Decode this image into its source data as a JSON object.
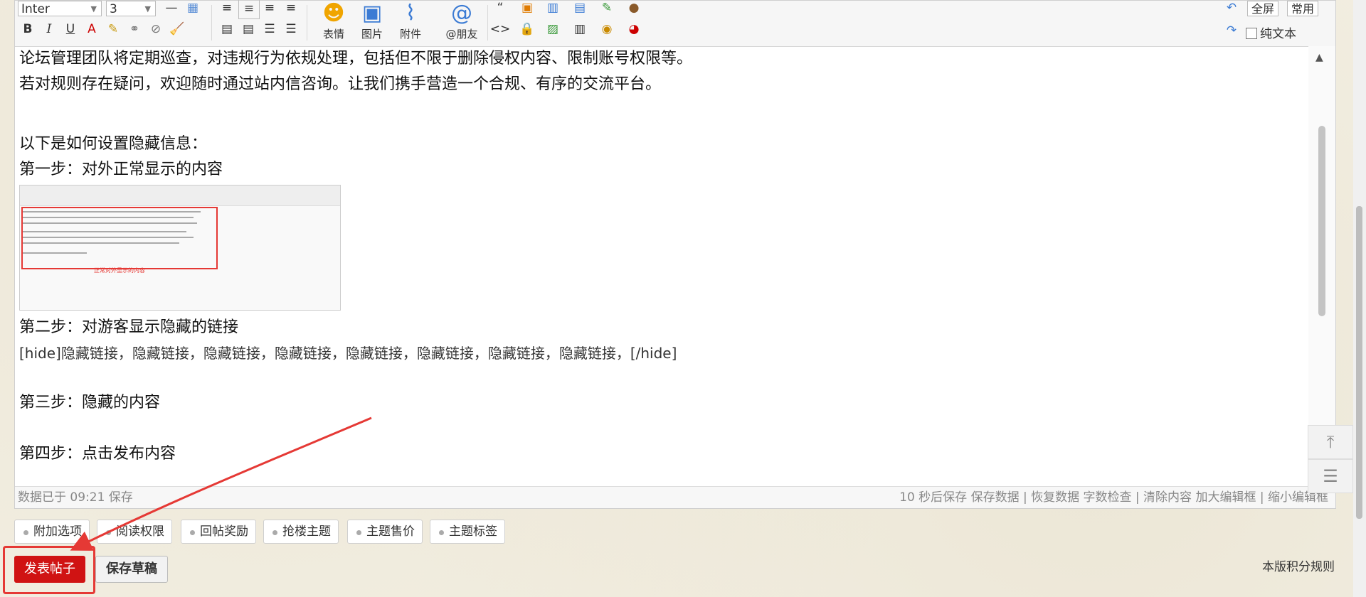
{
  "toolbar": {
    "font_select": "Inter",
    "size_select": "3",
    "big_buttons": [
      {
        "label": "表情"
      },
      {
        "label": "图片"
      },
      {
        "label": "附件"
      },
      {
        "label": "@朋友"
      }
    ],
    "fullscreen_label": "全屏",
    "common_label": "常用",
    "plaintext_label": "纯文本"
  },
  "content": {
    "lines": [
      "论坛管理团队将定期巡查，对违规行为依规处理，包括但不限于删除侵权内容、限制账号权限等。",
      "若对规则存在疑问，欢迎随时通过站内信咨询。让我们携手营造一个合规、有序的交流平台。",
      "以下是如何设置隐藏信息：",
      "第一步：对外正常显示的内容",
      "第二步：对游客显示隐藏的链接",
      "[hide]隐藏链接，隐藏链接，隐藏链接，隐藏链接，隐藏链接，隐藏链接，隐藏链接，隐藏链接，[/hide]",
      "第三步：隐藏的内容",
      "第四步：点击发布内容"
    ],
    "thumbnail_caption": "正常对外显示的内容"
  },
  "status": {
    "saved": "数据已于 09:21 保存",
    "right": "10 秒后保存 保存数据 | 恢复数据    字数检查 | 清除内容    加大编辑框 | 缩小编辑框"
  },
  "tabs": [
    "附加选项",
    "阅读权限",
    "回帖奖励",
    "抢楼主题",
    "主题售价",
    "主题标签"
  ],
  "actions": {
    "publish": "发表帖子",
    "draft": "保存草稿",
    "rules": "本版积分规则"
  },
  "colors": {
    "publish_bg": "#d01313",
    "annotation": "#e53935"
  }
}
